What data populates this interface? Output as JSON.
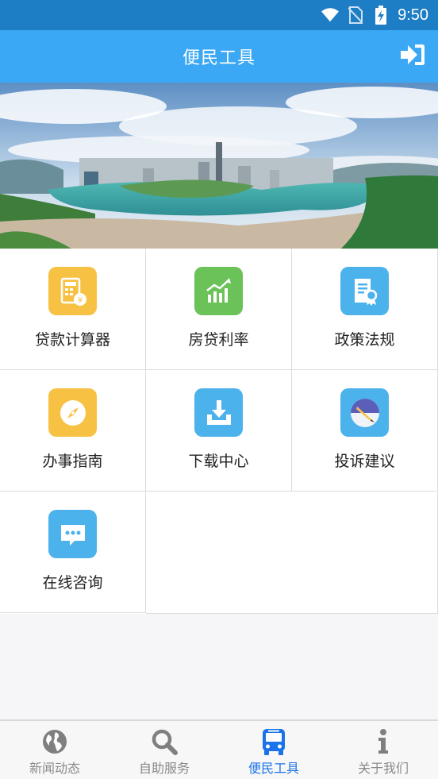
{
  "status_bar": {
    "time": "9:50",
    "icons": [
      "wifi-icon",
      "no-sim-icon",
      "battery-charging-icon"
    ]
  },
  "header": {
    "title": "便民工具",
    "login_icon": "login-icon"
  },
  "banner": {
    "image": "city-river-panorama"
  },
  "tools": [
    {
      "label": "贷款计算器",
      "icon": "loan-calculator-icon",
      "color": "#f7c244"
    },
    {
      "label": "房贷利率",
      "icon": "rising-chart-icon",
      "color": "#6ac259"
    },
    {
      "label": "政策法规",
      "icon": "certificate-document-icon",
      "color": "#4cb2ec"
    },
    {
      "label": "办事指南",
      "icon": "compass-icon",
      "color": "#f7c244"
    },
    {
      "label": "下载中心",
      "icon": "download-tray-icon",
      "color": "#4cb2ec"
    },
    {
      "label": "投诉建议",
      "icon": "pen-plate-icon",
      "color": "#4cb2ec"
    },
    {
      "label": "在线咨询",
      "icon": "chat-bubble-icon",
      "color": "#4cb2ec"
    }
  ],
  "bottom_nav": [
    {
      "label": "新闻动态",
      "icon": "globe-icon",
      "active": false
    },
    {
      "label": "自助服务",
      "icon": "search-icon",
      "active": false
    },
    {
      "label": "便民工具",
      "icon": "bus-icon",
      "active": true
    },
    {
      "label": "关于我们",
      "icon": "info-icon",
      "active": false
    }
  ],
  "colors": {
    "status_bar": "#1d7dc5",
    "app_bar": "#3ba8f5",
    "nav_active": "#1a73e8",
    "nav_inactive": "#8a8a8a"
  }
}
